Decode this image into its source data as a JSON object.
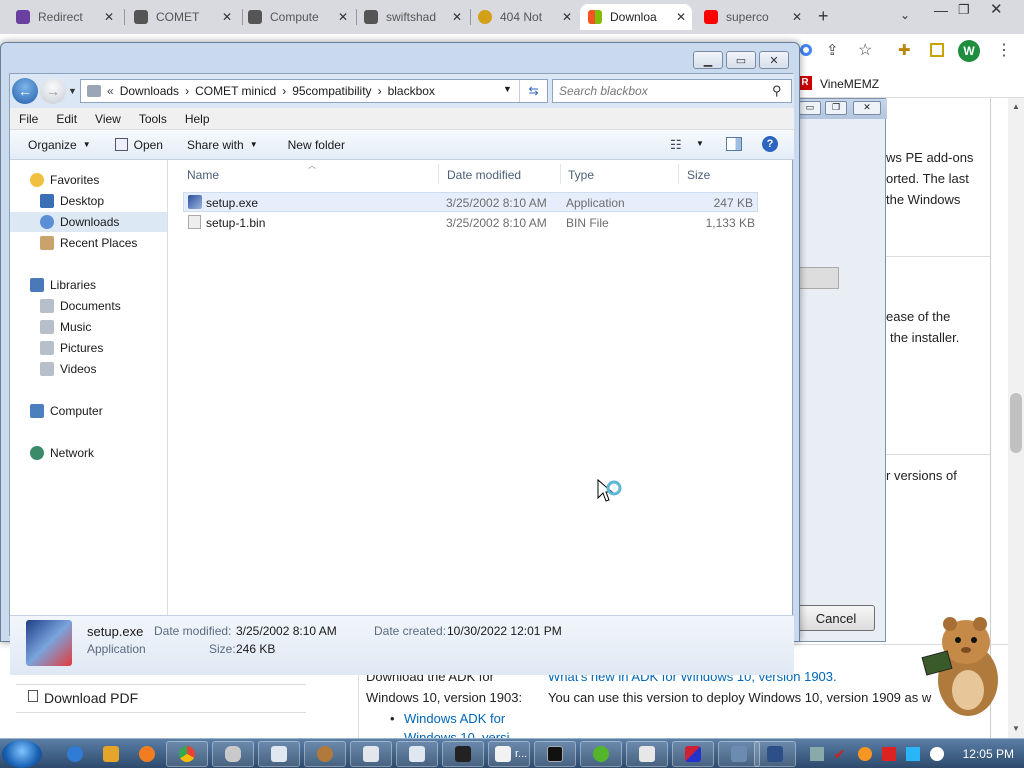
{
  "browser": {
    "tabs": [
      {
        "label": "Redirect",
        "color": "#9b59b6"
      },
      {
        "label": "COMET",
        "color": "#333333"
      },
      {
        "label": "Compute",
        "color": "#333333"
      },
      {
        "label": "swiftshad",
        "color": "#333333"
      },
      {
        "label": "404 Not",
        "color": "#d4a017"
      },
      {
        "label": "Downloa",
        "color": "#f35325"
      },
      {
        "label": "superco",
        "color": "#ff0000"
      }
    ],
    "bookmark": "VineMEMZ",
    "profile_initial": "W"
  },
  "webpage": {
    "right_texts": [
      "ws PE add-ons",
      "orted. The last",
      "the Windows",
      "ease of the",
      "the installer.",
      "r versions of"
    ],
    "download_pdf": "Download PDF",
    "adk_left_1": "Download the ADK for",
    "adk_left_2": "Windows 10, version 1903:",
    "adk_link": "What's new in ADK for Windows 10, version 1903.",
    "adk_desc": "You can use this version to deploy Windows 10, version 1909 as w",
    "bullet_link": "Windows ADK for",
    "bullet_cut": "Windows 10, versi"
  },
  "dialog": {
    "cancel": "Cancel"
  },
  "explorer": {
    "breadcrumb": [
      "Downloads",
      "COMET minicd",
      "95compatibility",
      "blackbox"
    ],
    "search_placeholder": "Search blackbox",
    "menu": [
      "File",
      "Edit",
      "View",
      "Tools",
      "Help"
    ],
    "commands": {
      "organize": "Organize",
      "open": "Open",
      "share": "Share with",
      "newfolder": "New folder"
    },
    "nav": {
      "favorites": "Favorites",
      "desktop": "Desktop",
      "downloads": "Downloads",
      "recent": "Recent Places",
      "libraries": "Libraries",
      "documents": "Documents",
      "music": "Music",
      "pictures": "Pictures",
      "videos": "Videos",
      "computer": "Computer",
      "network": "Network"
    },
    "columns": {
      "name": "Name",
      "date": "Date modified",
      "type": "Type",
      "size": "Size"
    },
    "files": [
      {
        "name": "setup.exe",
        "date": "3/25/2002 8:10 AM",
        "type": "Application",
        "size": "247 KB"
      },
      {
        "name": "setup-1.bin",
        "date": "3/25/2002 8:10 AM",
        "type": "BIN File",
        "size": "1,133 KB"
      }
    ],
    "details": {
      "name": "setup.exe",
      "kind": "Application",
      "date_modified_label": "Date modified:",
      "date_modified": "3/25/2002 8:10 AM",
      "size_label": "Size:",
      "size": "246 KB",
      "date_created_label": "Date created:",
      "date_created": "10/30/2022 12:01 PM"
    }
  },
  "taskbar": {
    "clock": "12:05 PM",
    "pinned": [
      "ie-icon",
      "media-player-icon",
      "firefox-icon",
      "chrome-icon",
      "mouse-icon",
      "window-icon",
      "hamster-icon",
      "folder-icon",
      "explorer-icon",
      "7zip-icon",
      "notepad-icon",
      "cmd-icon",
      "xbox-icon",
      "clipboard-icon",
      "paint-icon",
      "network-icon",
      "computer-icon"
    ],
    "truncated_label": "r..."
  }
}
